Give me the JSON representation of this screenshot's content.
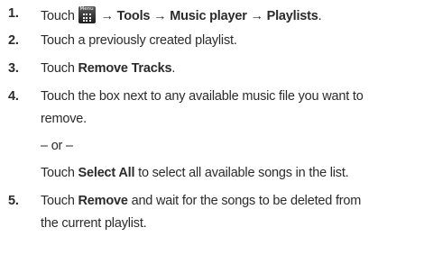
{
  "steps": [
    {
      "num": "1.",
      "icon": "menu-key-icon",
      "icon_label": "Menu",
      "parts": [
        "→ Tools → Music player → Playlists",
        "."
      ]
    },
    {
      "num": "2.",
      "text": "Touch a previously created playlist."
    },
    {
      "num": "3.",
      "prefix": "Touch ",
      "bold": "Remove Tracks",
      "suffix": "."
    },
    {
      "num": "4.",
      "line1": "Touch the box next to any available music file you want to",
      "line2": "remove.",
      "or": "– or –",
      "alt_prefix": "Touch ",
      "alt_bold": "Select All",
      "alt_suffix": " to select all available songs in the list."
    },
    {
      "num": "5.",
      "prefix": "Touch ",
      "bold": "Remove",
      "suffix": " and wait for the songs to be deleted from",
      "line2": "the current playlist."
    }
  ],
  "step1_touch": "Touch"
}
